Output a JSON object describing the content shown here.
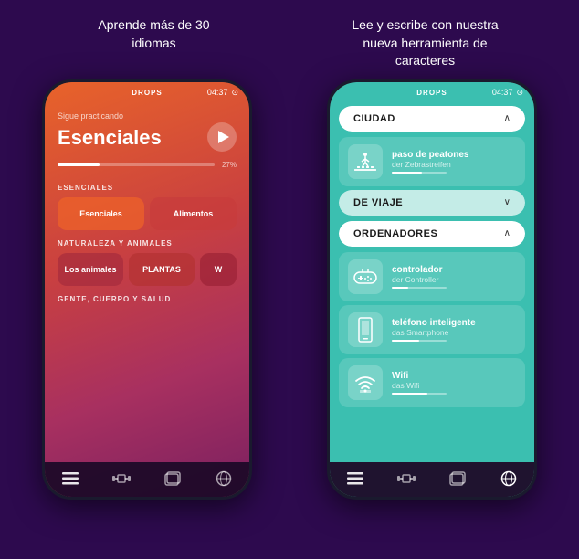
{
  "header": {
    "left_title": "Aprende más de 30\nidiomas",
    "right_title": "Lee y escribe con nuestra\nnueva herramienta de\ncaracteres"
  },
  "phone1": {
    "app_name": "DROPS",
    "time": "04:37",
    "continues_label": "Sigue practicando",
    "main_title": "Esenciales",
    "progress_pct": "27%",
    "progress_value": 27,
    "categories": [
      {
        "label": "ESENCIALES",
        "cards": [
          "Esenciales",
          "Alimentos"
        ]
      },
      {
        "label": "NATURALEZA Y ANIMALES",
        "cards": [
          "Los animales",
          "PLANTAS",
          "W"
        ]
      },
      {
        "label": "GENTE, CUERPO Y SALUD",
        "cards": []
      }
    ]
  },
  "phone2": {
    "app_name": "DROPS",
    "time": "04:37",
    "sections": [
      {
        "id": "ciudad",
        "title": "CIUDAD",
        "expanded": true,
        "items": [
          {
            "icon": "🚶",
            "main": "paso de peatones",
            "sub": "der Zebrastreifen",
            "progress": 55
          }
        ]
      },
      {
        "id": "de_viaje",
        "title": "DE VIAJE",
        "expanded": false,
        "items": []
      },
      {
        "id": "ordenadores",
        "title": "ORDENADORES",
        "expanded": true,
        "items": [
          {
            "icon": "🎮",
            "main": "controlador",
            "sub": "der Controller",
            "progress": 30
          },
          {
            "icon": "📱",
            "main": "teléfono inteligente",
            "sub": "das Smartphone",
            "progress": 50
          },
          {
            "icon": "📶",
            "main": "Wifi",
            "sub": "das Wifi",
            "progress": 65
          }
        ]
      }
    ]
  },
  "nav": {
    "items": [
      "list",
      "dumbbell",
      "cards",
      "globe"
    ]
  }
}
